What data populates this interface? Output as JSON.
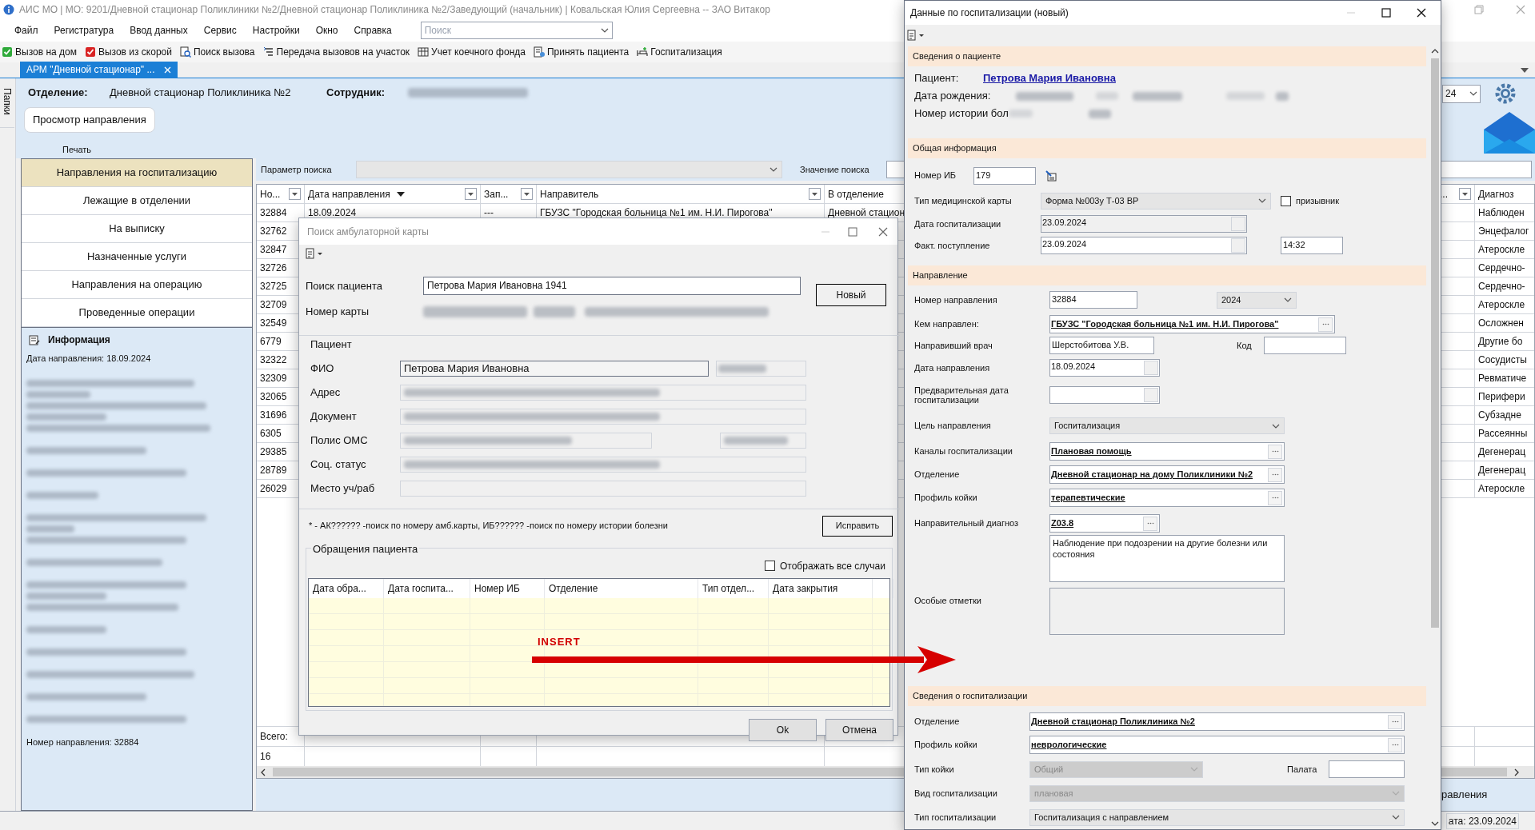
{
  "app": {
    "title": "АИС МО | МО: 9201/Дневной стационар Поликлиники №2/Дневной стационар Поликлиника №2/Заведующий (начальник) | Ковальская Юлия Сергеевна -- ЗАО Витакор",
    "menu": [
      "Файл",
      "Регистратура",
      "Ввод данных",
      "Сервис",
      "Настройки",
      "Окно",
      "Справка"
    ],
    "search_placeholder": "Поиск",
    "toolbar": [
      {
        "label": "Вызов на дом",
        "kind": "green-check"
      },
      {
        "label": "Вызов из скорой",
        "kind": "red-check"
      },
      {
        "label": "Поиск вызова",
        "kind": "search"
      },
      {
        "label": "Передача вызовов на участок",
        "kind": "transfer"
      },
      {
        "label": "Учет коечного фонда",
        "kind": "beds"
      },
      {
        "label": "Принять пациента",
        "kind": "accept"
      },
      {
        "label": "Госпитализация",
        "kind": "hospital"
      }
    ],
    "tabs": [
      {
        "label": "АРМ \"Дневной стационар\" ...",
        "selected": true
      }
    ],
    "folders_label": "Папки"
  },
  "header": {
    "department_label": "Отделение:",
    "department": "Дневной стационар Поликлиника №2",
    "employee_label": "Сотрудник:",
    "year": "24",
    "view_button": "Просмотр направления",
    "print_label": "Печать"
  },
  "nav": [
    {
      "label": "Направления на госпитализацию",
      "selected": true
    },
    {
      "label": "Лежащие в отделении",
      "selected": false
    },
    {
      "label": "На выписку",
      "selected": false
    },
    {
      "label": "Назначенные услуги",
      "selected": false
    },
    {
      "label": "Направления на операцию",
      "selected": false
    },
    {
      "label": "Проведенные операции",
      "selected": false
    }
  ],
  "info": {
    "title": "Информация",
    "referral_date": "Дата направления: 18.09.2024",
    "referral_number": "Номер направления: 32884"
  },
  "grid": {
    "search_param_label": "Параметр поиска",
    "search_value_label": "Значение поиска",
    "columns": [
      {
        "label": "Но...",
        "filter": true,
        "sorted": false
      },
      {
        "label": "Дата направления",
        "filter": true,
        "sorted": true
      },
      {
        "label": "Зап...",
        "filter": true,
        "sorted": false
      },
      {
        "label": "Направитель",
        "filter": true,
        "sorted": false
      },
      {
        "label": "В отделение",
        "filter": false,
        "sorted": false
      },
      {
        "label": "...",
        "filter": true,
        "sorted": false
      },
      {
        "label": "Диагноз",
        "filter": false,
        "sorted": false
      }
    ],
    "rows": [
      {
        "number": "32884",
        "date": "18.09.2024",
        "column_3": "---",
        "referrer": "ГБУЗС \"Городская больница №1 им. Н.И. Пирогова\"",
        "department": "Дневной стацион",
        "diagnosis": "Наблюден"
      },
      {
        "number": "32762",
        "diagnosis": "Энцефалог"
      },
      {
        "number": "32847",
        "diagnosis": "Атероскле"
      },
      {
        "number": "32726",
        "diagnosis": "Сердечно-"
      },
      {
        "number": "32725",
        "diagnosis": "Сердечно-"
      },
      {
        "number": "32709",
        "diagnosis": "Атероскле"
      },
      {
        "number": "32549",
        "diagnosis": "Осложнен"
      },
      {
        "number": "6779",
        "diagnosis": "Другие бо"
      },
      {
        "number": "32322",
        "diagnosis": "Сосудисты"
      },
      {
        "number": "32309",
        "diagnosis": "Ревматиче"
      },
      {
        "number": "32065",
        "diagnosis": "Перифери"
      },
      {
        "number": "31696",
        "diagnosis": "Субзадне"
      },
      {
        "number": "6305",
        "diagnosis": "Рассеянны"
      },
      {
        "number": "29385",
        "diagnosis": "Дегенерац"
      },
      {
        "number": "28789",
        "diagnosis": "Дегенерац"
      },
      {
        "number": "26029",
        "diagnosis": "Атероскле"
      }
    ],
    "total_label": "Всего:",
    "total": "16"
  },
  "right_edge": {
    "button_tail": "равления",
    "status_tail": "ата: 23.09.2024"
  },
  "search_dialog": {
    "title": "Поиск амбулаторной карты",
    "search_label": "Поиск пациента",
    "search_value": "Петрова Мария Ивановна 1941",
    "new_button": "Новый",
    "card_label": "Номер карты",
    "patient_group": "Пациент",
    "fields": [
      {
        "label": "ФИО",
        "kind": "name",
        "value": "Петрова Мария Ивановна"
      },
      {
        "label": "Адрес",
        "kind": "blurred"
      },
      {
        "label": "Документ",
        "kind": "blurred"
      },
      {
        "label": "Полис ОМС",
        "kind": "blurred-split"
      },
      {
        "label": "Соц. статус",
        "kind": "blurred"
      },
      {
        "label": "Место уч/раб",
        "kind": "empty"
      }
    ],
    "hint": "* - АК?????? -поиск по номеру амб.карты, ИБ?????? -поиск по номеру истории болезни",
    "fix_button": "Исправить",
    "visits_group": "Обращения пациента",
    "show_all": {
      "label": "Отображать все случаи",
      "checked": false
    },
    "visit_columns": [
      "Дата обра...",
      "Дата госпита...",
      "Номер ИБ",
      "Отделение",
      "Тип отдел...",
      "Дата закрытия"
    ],
    "ok_button": "Ok",
    "cancel_button": "Отмена"
  },
  "hosp_dialog": {
    "title": "Данные по госпитализации (новый)",
    "patient": {
      "title": "Сведения о пациенте",
      "patient_label": "Пациент:",
      "patient": "Петрова Мария Ивановна",
      "birth_label": "Дата рождения:",
      "history_label": "Номер истории бол"
    },
    "general": {
      "title": "Общая информация",
      "ib_label": "Номер ИБ",
      "ib": "179",
      "card_type_label": "Тип медицинской карты",
      "card_type": "Форма №003у Т-03 ВР",
      "conscript": {
        "label": "призывник",
        "checked": false
      },
      "hosp_date_label": "Дата госпитализации",
      "hosp_date": {
        "value": "23.09.2024",
        "disabled": true
      },
      "arrival_label": "Факт. поступление",
      "arrival": {
        "value": "23.09.2024",
        "disabled": false
      },
      "arrival_time": "14:32"
    },
    "referral": {
      "title": "Направление",
      "number_label": "Номер направления",
      "number": "32884",
      "year": "2024",
      "by_label": "Кем направлен:",
      "by": "ГБУЗС \"Городская больница №1 им. Н.И. Пирогова\"",
      "doctor_label": "Направивший врач",
      "doctor": "Шерстобитова У.В.",
      "code_label": "Код",
      "date_label": "Дата направления",
      "date": "18.09.2024",
      "planned_label": "Предварительная дата госпитализации",
      "purpose_label": "Цель направления",
      "purpose": "Госпитализация",
      "channels_label": "Каналы госпитализации",
      "channels": "Плановая помощь",
      "department_label": "Отделение",
      "department": "Дневной стационар на дому Поликлиники №2",
      "bed_profile_label": "Профиль койки",
      "bed_profile": "терапевтические",
      "diagnosis_label": "Направительный диагноз",
      "diagnosis_code": "Z03.8",
      "diagnosis_text": "Наблюдение при подозрении на другие болезни или состояния",
      "notes_label": "Особые отметки"
    },
    "hospitalization": {
      "title": "Сведения о госпитализации",
      "department_label": "Отделение",
      "department": "Дневной стационар Поликлиника №2",
      "bed_profile_label": "Профиль койки",
      "bed_profile": "неврологические",
      "bed_type_label": "Тип койки",
      "bed_type": {
        "value": "Общий",
        "disabled": true
      },
      "ward_label": "Палата",
      "hosp_kind_label": "Вид госпитализации",
      "hosp_kind": {
        "value": "плановая",
        "disabled": true
      },
      "type_label": "Тип госпитализации",
      "type": {
        "value": "Госпитализация с направлением",
        "disabled": false
      }
    }
  },
  "annotation": {
    "label": "INSERT"
  }
}
